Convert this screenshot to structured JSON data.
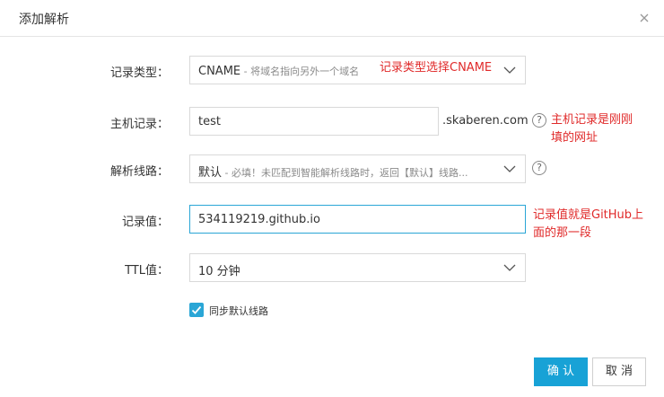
{
  "dialog": {
    "title": "添加解析",
    "close_icon": "close-icon"
  },
  "form": {
    "record_type": {
      "label": "记录类型：",
      "value": "CNAME",
      "hint": " - 将域名指向另外一个域名"
    },
    "host": {
      "label": "主机记录：",
      "value": "test",
      "suffix": ".skaberen.com"
    },
    "line": {
      "label": "解析线路：",
      "value": "默认",
      "hint": " - 必填！未匹配到智能解析线路时，返回【默认】线路..."
    },
    "record_value": {
      "label": "记录值：",
      "value": "534119219.github.io"
    },
    "ttl": {
      "label": "TTL值：",
      "value": "10 分钟"
    },
    "sync_default": {
      "label": "同步默认线路",
      "checked": true
    }
  },
  "annotations": {
    "type_note": "记录类型选择CNAME",
    "host_note_1": "主机记录是刚刚",
    "host_note_2": "填的网址",
    "value_note_1": "记录值就是GitHub上",
    "value_note_2": "面的那一段"
  },
  "buttons": {
    "confirm": "确 认",
    "cancel": "取 消"
  },
  "colors": {
    "accent": "#18a2d6",
    "annotation": "#e02a2a"
  }
}
